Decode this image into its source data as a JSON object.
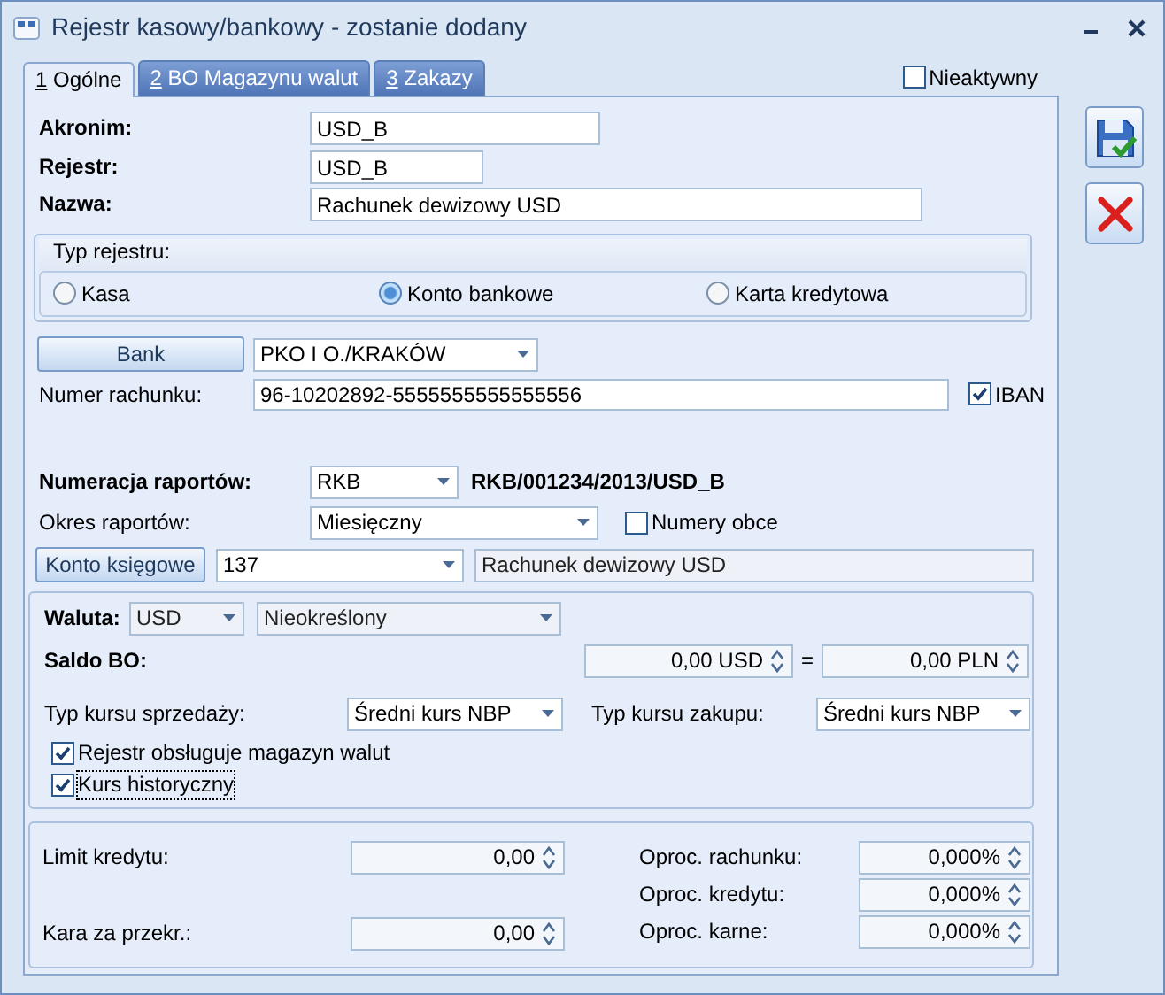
{
  "window": {
    "title": "Rejestr kasowy/bankowy - zostanie dodany"
  },
  "tabs": [
    {
      "key": "1",
      "label": "Ogólne",
      "selected": true
    },
    {
      "key": "2",
      "label": "BO Magazynu walut",
      "selected": false
    },
    {
      "key": "3",
      "label": "Zakazy",
      "selected": false
    }
  ],
  "inactive": {
    "label": "Nieaktywny",
    "checked": false
  },
  "akronim": {
    "label": "Akronim:",
    "value": "USD_B"
  },
  "rejestr": {
    "label": "Rejestr:",
    "value": "USD_B"
  },
  "nazwa": {
    "label": "Nazwa:",
    "value": "Rachunek dewizowy USD"
  },
  "register_type": {
    "title": "Typ rejestru:",
    "options": [
      {
        "label": "Kasa",
        "selected": false
      },
      {
        "label": "Konto bankowe",
        "selected": true
      },
      {
        "label": "Karta kredytowa",
        "selected": false
      }
    ]
  },
  "bank": {
    "button": "Bank",
    "value": "PKO I O./KRAKÓW"
  },
  "account_number": {
    "label": "Numer rachunku:",
    "value": "96-10202892-5555555555555556",
    "iban": {
      "label": "IBAN",
      "checked": true
    }
  },
  "report_numbering": {
    "label": "Numeracja raportów:",
    "value": "RKB",
    "preview": "RKB/001234/2013/USD_B"
  },
  "report_period": {
    "label": "Okres raportów:",
    "value": "Miesięczny",
    "foreign_numbers": {
      "label": "Numery obce",
      "checked": false
    }
  },
  "ledger_account": {
    "button": "Konto księgowe",
    "value": "137",
    "name": "Rachunek dewizowy USD"
  },
  "currency": {
    "label": "Waluta:",
    "value": "USD",
    "type": "Nieokreślony",
    "disabled": true
  },
  "opening_balance": {
    "label": "Saldo BO:",
    "value": "0,00 USD",
    "equals": "=",
    "value_pln": "0,00 PLN"
  },
  "sell_rate": {
    "label": "Typ kursu sprzedaży:",
    "value": "Średni kurs NBP"
  },
  "buy_rate": {
    "label": "Typ kursu zakupu:",
    "value": "Średni kurs NBP"
  },
  "options": [
    {
      "label": "Rejestr obsługuje magazyn walut",
      "checked": true,
      "focused": false
    },
    {
      "label": "Kurs historyczny",
      "checked": true,
      "focused": true
    }
  ],
  "limits": {
    "left": [
      {
        "label": "Limit kredytu:",
        "value": "0,00"
      },
      {
        "label": "Kara za przekr.:",
        "value": "0,00"
      }
    ],
    "right": [
      {
        "label": "Oproc. rachunku:",
        "value": "0,000%"
      },
      {
        "label": "Oproc. kredytu:",
        "value": "0,000%"
      },
      {
        "label": "Oproc. karne:",
        "value": "0,000%"
      }
    ]
  }
}
